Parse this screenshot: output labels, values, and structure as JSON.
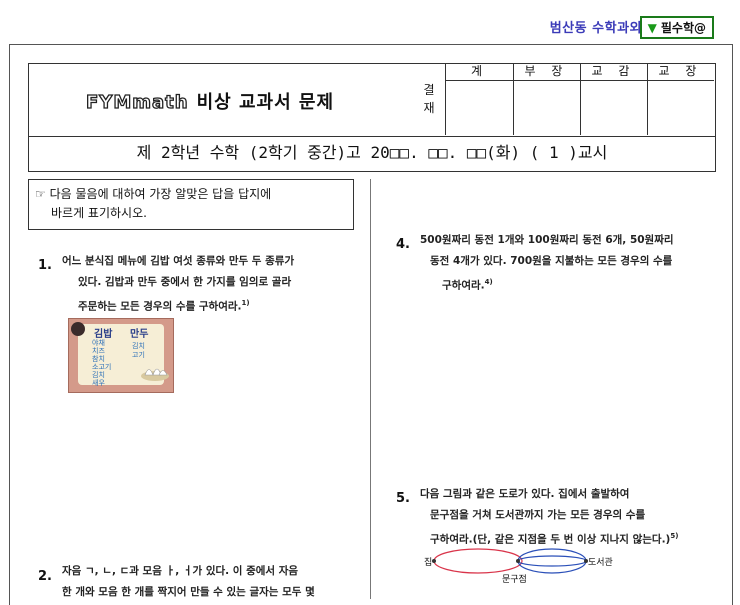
{
  "top": {
    "brand": "범산동 수학과외",
    "badge": "필수학@"
  },
  "header": {
    "logo": "FYMmath",
    "title": "비상 교과서 문제",
    "approval_label": [
      "결",
      "재"
    ],
    "approval_cols": [
      "계",
      "부 장",
      "교 감",
      "교 장"
    ],
    "subtitle": "제 2학년 수학  (2학기 중간)고   20□□. □□. □□(화)  ( 1 )교시"
  },
  "instruction": {
    "symbol": "☞",
    "line1": "다음 물음에 대하여 가장 알맞은 답을 답지에",
    "line2": "바르게 표기하시오."
  },
  "q1": {
    "num": "1.",
    "line1": "어느 분식집 메뉴에 김밥 여섯 종류와 만두 두 종류가",
    "line2": "있다. 김밥과 만두 중에서 한 가지를 임의로 골라",
    "line3": "주문하는 모든 경우의 수를 구하여라.",
    "foot": "1)",
    "menu": {
      "left_title": "김밥",
      "right_title": "만두",
      "left_items": [
        "야채",
        "치즈",
        "참치",
        "소고기",
        "김치",
        "새우"
      ],
      "right_items": [
        "김치",
        "고기"
      ]
    }
  },
  "q2": {
    "num": "2.",
    "line1": "자음 ㄱ, ㄴ, ㄷ과 모음 ㅏ, ㅓ가 있다. 이 중에서 자음",
    "line2": "한 개와 모음 한 개를 짝지어 만들 수 있는 글자는 모두 몇"
  },
  "q4": {
    "num": "4.",
    "line1": "500원짜리 동전 1개와 100원짜리 동전 6개, 50원짜리",
    "line2": "동전 4개가 있다. 700원을 지불하는 모든 경우의 수를",
    "line3": "구하여라.",
    "foot": "4)"
  },
  "q5": {
    "num": "5.",
    "line1": "다음 그림과 같은 도로가 있다. 집에서 출발하여",
    "line2": "문구점을 거쳐 도서관까지 가는 모든 경우의 수를",
    "line3": "구하여라.(단, 같은 지점을 두 번 이상 지나지 않는다.)",
    "foot": "5)",
    "diagram": {
      "home": "집",
      "store": "문구점",
      "library": "도서관"
    }
  },
  "colors": {
    "brand": "#3b3bb8",
    "badge_border": "#1a7a1a",
    "road_red": "#d9344a",
    "road_blue": "#2a4fb8"
  }
}
